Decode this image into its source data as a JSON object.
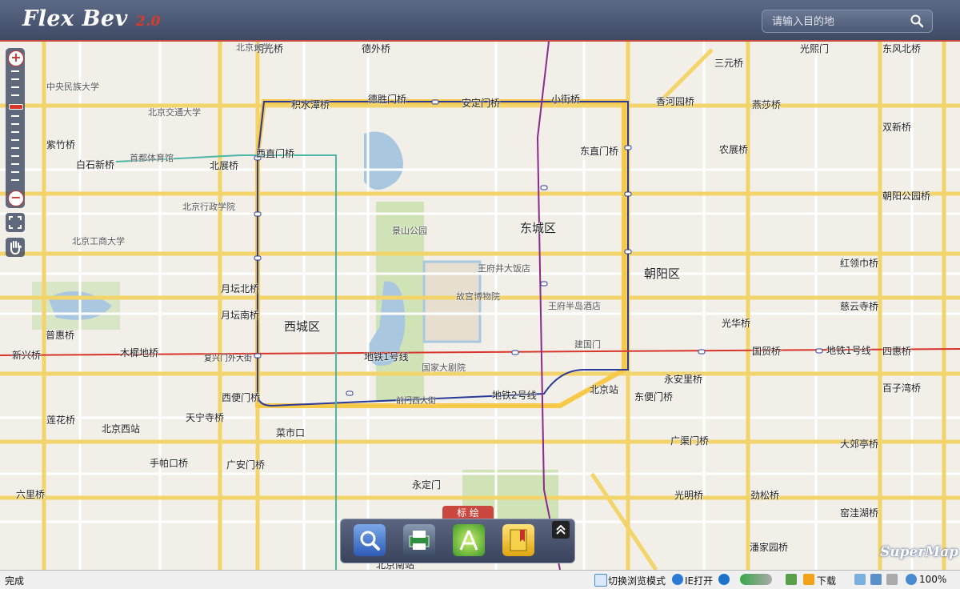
{
  "header": {
    "logo": "Flex Bev",
    "version": "2.0",
    "search_placeholder": "请输入目的地"
  },
  "map": {
    "districts": [
      "西城区",
      "东城区",
      "朝阳区"
    ],
    "lines": [
      "地铁1号线",
      "地铁2号线",
      "地铁1号线"
    ],
    "labels": [
      "明光桥",
      "德外桥",
      "积水潭桥",
      "德胜门桥",
      "安定门桥",
      "小街桥",
      "三元桥",
      "西直门桥",
      "东直门桥",
      "农展桥",
      "首都体育馆",
      "北展桥",
      "白石新桥",
      "紫竹桥",
      "月坛北桥",
      "月坛南桥",
      "木樨地桥",
      "复兴门外大街",
      "新兴桥",
      "普惠桥",
      "故宫博物院",
      "景山公园",
      "国家大剧院",
      "王府井大饭店",
      "王府半岛酒店",
      "北京站",
      "建国门",
      "永安里桥",
      "国贸桥",
      "四惠桥",
      "光华桥",
      "慈云寺桥",
      "红领巾桥",
      "朝阳公园桥",
      "双新桥",
      "东风北桥",
      "香河园桥",
      "燕莎桥",
      "光熙门",
      "天宁寺桥",
      "西便门桥",
      "东便门桥",
      "莲花桥",
      "北京西站",
      "手帕口桥",
      "广安门桥",
      "菜市口",
      "前门西大街",
      "北京南站",
      "永定门",
      "广渠门桥",
      "大郊亭桥",
      "百子湾桥",
      "光明桥",
      "劲松桥",
      "潘家园桥",
      "窑洼湖桥",
      "六里桥",
      "北京交通大学",
      "北京大学",
      "中央民族大学",
      "北京工商大学",
      "北京行政学院"
    ]
  },
  "dock": {
    "tab_label": "标 绘",
    "buttons": [
      "search-tool",
      "print-tool",
      "plot-tool",
      "bookmark-tool"
    ]
  },
  "watermark": "SuperMap",
  "status_bar": {
    "left_text": "完成",
    "switch_mode": "切换浏览模式",
    "ie_open": "IE打开",
    "download": "下载",
    "zoom": "100%"
  },
  "colors": {
    "header": "#4a5672",
    "accent": "#c9473f",
    "line1": "#d8362c",
    "line2": "#2a3a9a",
    "line4": "#4cb7a4",
    "line5": "#8a2a8a"
  }
}
